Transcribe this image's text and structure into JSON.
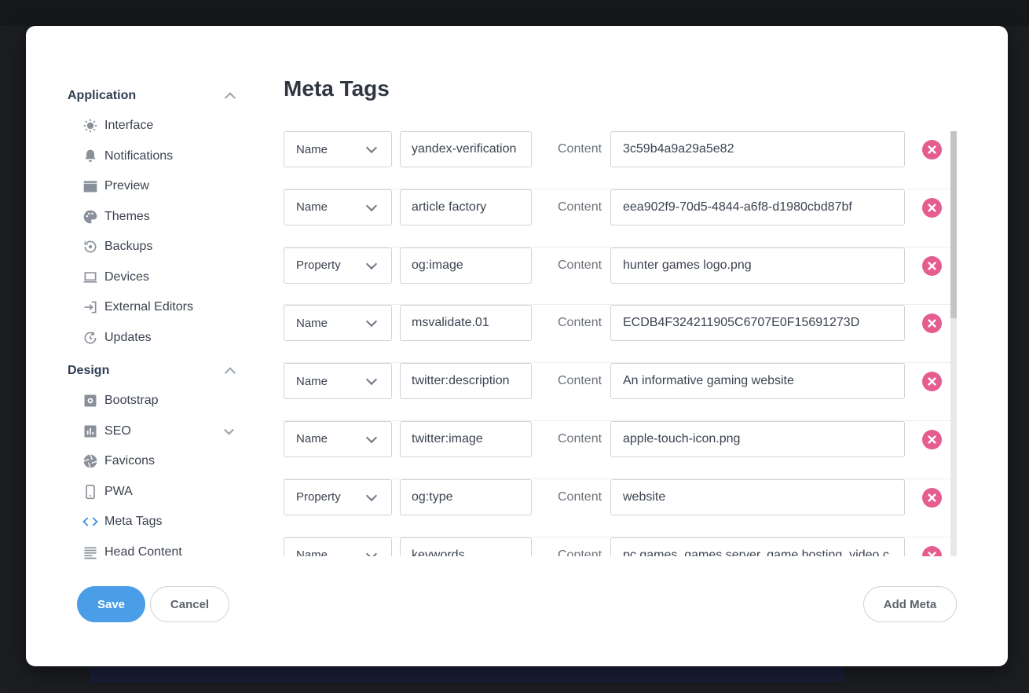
{
  "sidebar": {
    "sections": [
      {
        "title": "Application",
        "expanded": true,
        "items": [
          {
            "label": "Interface",
            "icon": "sun-icon"
          },
          {
            "label": "Notifications",
            "icon": "bell-icon"
          },
          {
            "label": "Preview",
            "icon": "clapperboard-icon"
          },
          {
            "label": "Themes",
            "icon": "palette-icon"
          },
          {
            "label": "Backups",
            "icon": "history-icon"
          },
          {
            "label": "Devices",
            "icon": "laptop-icon"
          },
          {
            "label": "External Editors",
            "icon": "export-icon"
          },
          {
            "label": "Updates",
            "icon": "refresh-icon"
          }
        ]
      },
      {
        "title": "Design",
        "expanded": true,
        "items": [
          {
            "label": "Bootstrap",
            "icon": "gear-icon"
          },
          {
            "label": "SEO",
            "icon": "bar-chart-icon",
            "expandable": true
          },
          {
            "label": "Favicons",
            "icon": "aperture-icon"
          },
          {
            "label": "PWA",
            "icon": "phone-icon"
          },
          {
            "label": "Meta Tags",
            "icon": "code-icon",
            "active": true
          },
          {
            "label": "Head Content",
            "icon": "lines-icon"
          }
        ]
      }
    ]
  },
  "main": {
    "title": "Meta Tags",
    "content_label": "Content",
    "rows": [
      {
        "type": "Name",
        "key": "yandex-verification",
        "content": "3c59b4a9a29a5e82"
      },
      {
        "type": "Name",
        "key": "article factory",
        "content": "eea902f9-70d5-4844-a6f8-d1980cbd87bf"
      },
      {
        "type": "Property",
        "key": "og:image",
        "content": "hunter games logo.png"
      },
      {
        "type": "Name",
        "key": "msvalidate.01",
        "content": "ECDB4F324211905C6707E0F15691273D"
      },
      {
        "type": "Name",
        "key": "twitter:description",
        "content": "An informative gaming website"
      },
      {
        "type": "Name",
        "key": "twitter:image",
        "content": "apple-touch-icon.png"
      },
      {
        "type": "Property",
        "key": "og:type",
        "content": "website"
      },
      {
        "type": "Name",
        "key": "keywords",
        "content": "pc games, games server, game hosting, video c"
      }
    ]
  },
  "footer": {
    "save_label": "Save",
    "cancel_label": "Cancel",
    "add_label": "Add Meta"
  },
  "colors": {
    "accent": "#4a9ee8",
    "remove": "#e55d8f",
    "active_icon": "#3a8fde"
  }
}
